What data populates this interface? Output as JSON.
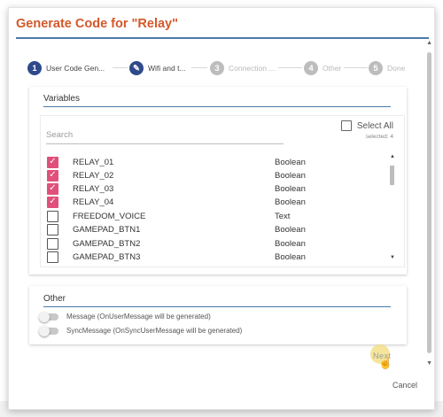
{
  "dialog": {
    "title": "Generate Code for \"Relay\""
  },
  "stepper": [
    {
      "number": "1",
      "label": "User Code Gen...",
      "state": "active"
    },
    {
      "number": "✎",
      "label": "Wifi and t...",
      "state": "active"
    },
    {
      "number": "3",
      "label": "Connection ...",
      "state": "inactive"
    },
    {
      "number": "4",
      "label": "Other",
      "state": "inactive"
    },
    {
      "number": "5",
      "label": "Done",
      "state": "inactive"
    }
  ],
  "variables": {
    "section_title": "Variables",
    "search_placeholder": "Search",
    "select_all_label": "Select All",
    "selected_count": "selected: 4",
    "rows": [
      {
        "name": "RELAY_01",
        "type": "Boolean",
        "checked": true
      },
      {
        "name": "RELAY_02",
        "type": "Boolean",
        "checked": true
      },
      {
        "name": "RELAY_03",
        "type": "Boolean",
        "checked": true
      },
      {
        "name": "RELAY_04",
        "type": "Boolean",
        "checked": true
      },
      {
        "name": "FREEDOM_VOICE",
        "type": "Text",
        "checked": false
      },
      {
        "name": "GAMEPAD_BTN1",
        "type": "Boolean",
        "checked": false
      },
      {
        "name": "GAMEPAD_BTN2",
        "type": "Boolean",
        "checked": false
      },
      {
        "name": "GAMEPAD_BTN3",
        "type": "Boolean",
        "checked": false
      }
    ]
  },
  "other": {
    "section_title": "Other",
    "toggles": [
      {
        "label": "Message (OnUserMessage will be generated)",
        "on": false
      },
      {
        "label": "SyncMessage (OnSyncUserMessage will be generated)",
        "on": false
      }
    ]
  },
  "actions": {
    "next_label": "Next",
    "cancel_label": "Cancel"
  },
  "colors": {
    "title": "#d4582a",
    "accent": "#4a7aa6",
    "step_active": "#2f4a8c",
    "checkbox_checked": "#e0507a"
  }
}
